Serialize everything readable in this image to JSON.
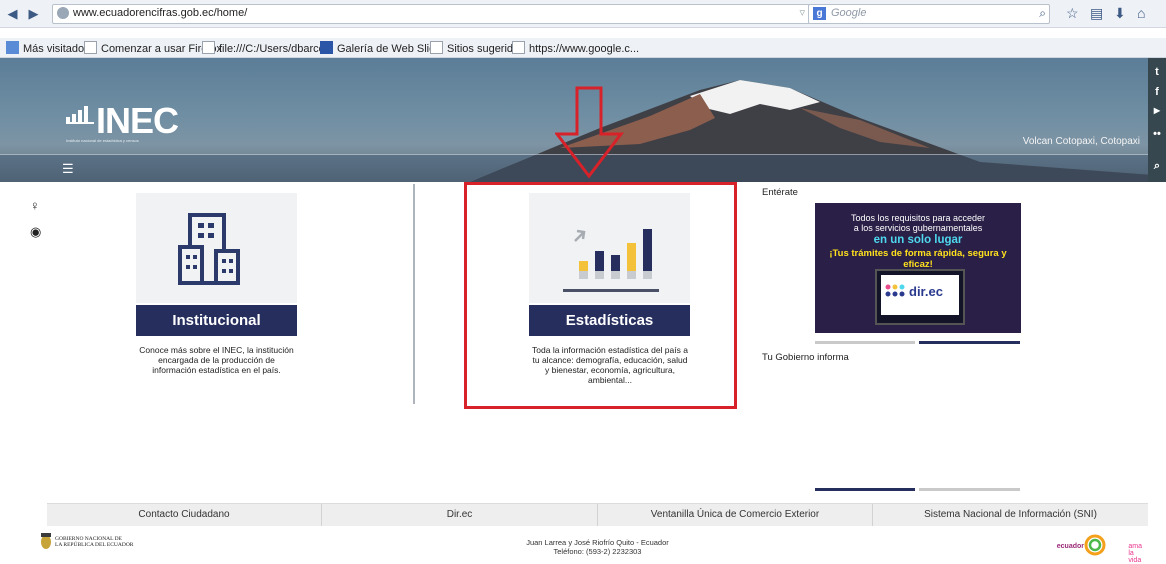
{
  "browser": {
    "url": "www.ecuadorencifras.gob.ec/home/",
    "search_placeholder": "Google",
    "bookmarks": [
      "Más visitados",
      "Comenzar a usar Firefox",
      "file:///C:/Users/dbarco...",
      "Galería de Web Slice",
      "Sitios sugeridos",
      "https://www.google.c..."
    ]
  },
  "hero": {
    "logo": "INEC",
    "logo_subtitle": "Instituto nacional de estadística y censos",
    "caption": "Volcan Cotopaxi, Cotopaxi",
    "menu_icon": "hamburger-icon"
  },
  "cards": {
    "institucional": {
      "button": "Institucional",
      "desc": [
        "Conoce más sobre el INEC, la institución",
        "encargada de la producción de",
        "información estadística en el país."
      ]
    },
    "estadisticas": {
      "button": "Estadísticas",
      "desc": [
        "Toda la información estadística del país a",
        "tu alcance: demografía, educación, salud",
        "y bienestar, economía, agricultura,",
        "ambiental..."
      ]
    }
  },
  "sidebar": {
    "enterate_label": "Entérate",
    "banner": {
      "line1": "Todos los requisitos para acceder",
      "line2": "a los servicios gubernamentales",
      "line3": "en un solo lugar",
      "line4": "¡Tus trámites de forma rápida, segura y eficaz!",
      "brand": "dir.ec"
    },
    "tu_gobierno_label": "Tu Gobierno informa"
  },
  "footer": {
    "links": [
      "Contacto Ciudadano",
      "Dir.ec",
      "Ventanilla Única de Comercio Exterior",
      "Sistema Nacional de Información (SNI)"
    ],
    "gov_line1": "GOBIERNO NACIONAL DE",
    "gov_line2": "LA REPÚBLICA DEL ECUADOR",
    "address": "Juan Larrea y José Riofrío Quito - Ecuador",
    "phone": "Teléfono: (593-2) 2232303",
    "ecuador_label": "ecuador",
    "ama_label": "ama la vida"
  },
  "colors": {
    "accent_navy": "#262e5e",
    "highlight_red": "#d8222a",
    "chart_yellow": "#f3c23a",
    "social_bar": "#36474f"
  }
}
